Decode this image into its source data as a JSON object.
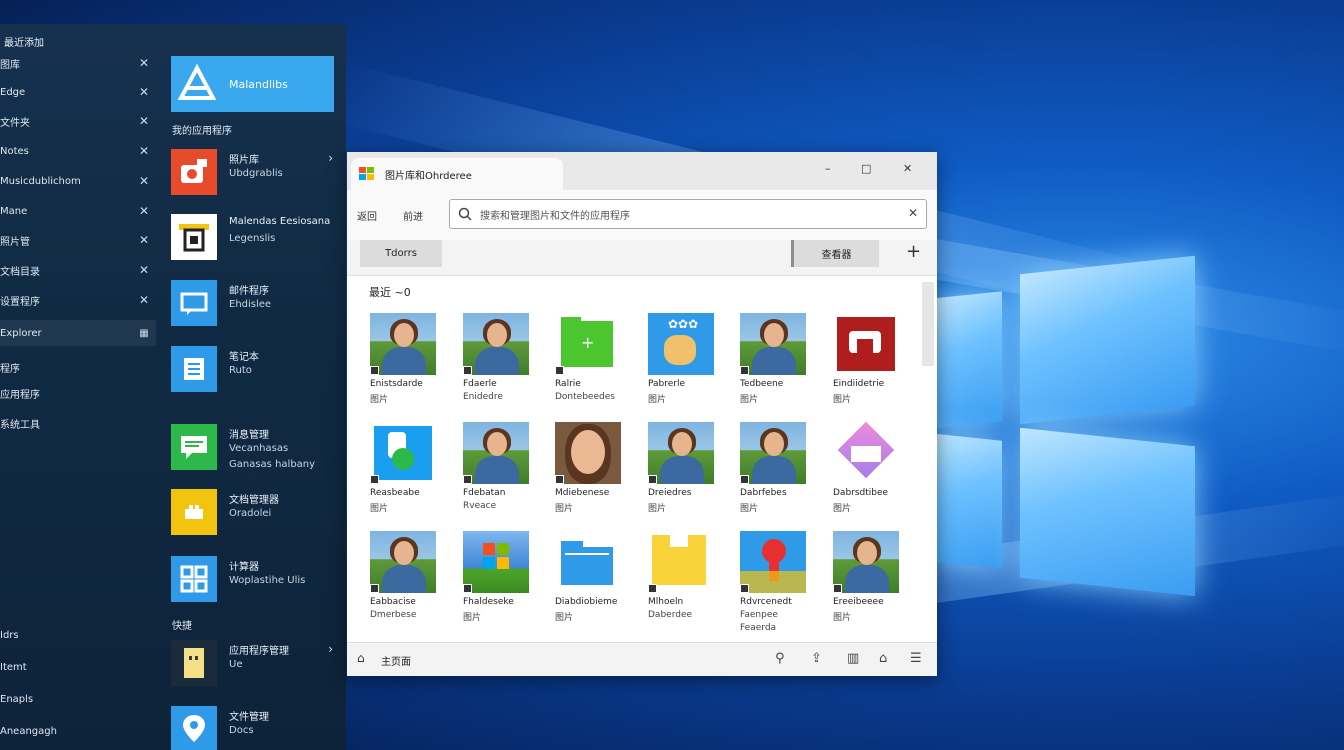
{
  "colors": {
    "hero_tile": "#3aa8ef",
    "start_bg": "#112a44",
    "window_bg": "#f3f3f3",
    "desktop_glow": "#6fc2ff"
  },
  "start_menu": {
    "header": "最近添加",
    "app_list": [
      {
        "label": "图库"
      },
      {
        "label": "Edge"
      },
      {
        "label": "文件夹"
      },
      {
        "label": "Notes"
      },
      {
        "label": "Musicdublichom"
      },
      {
        "label": "Mane"
      },
      {
        "label": "照片管"
      },
      {
        "label": "文档目录"
      },
      {
        "label": "设置程序"
      },
      {
        "label": "Explorer",
        "selected": true
      }
    ],
    "more_items": [
      "程序",
      "应用程序",
      "系统工具"
    ],
    "bottom_items": [
      "Idrs",
      "Itemt",
      "Enapls",
      "Aneangagh"
    ],
    "tiles": {
      "hero_label": "Malandlibs",
      "section1": "我的应用程序",
      "section2": "快捷",
      "items": [
        {
          "title": "照片库",
          "line2": "Ubdgrablis",
          "icon": "camera-icon",
          "color": "#e84a2c",
          "chevron": true
        },
        {
          "title": "Malendas Eesiosana",
          "line2": "Legenslis",
          "icon": "folder-doc-icon",
          "color": "#ffffff"
        },
        {
          "title": "邮件程序",
          "line2": "Ehdislee",
          "icon": "chat-window-icon",
          "color": "#2f9be8"
        },
        {
          "title": "笔记本",
          "line2": "Ruto",
          "icon": "notepad-icon",
          "color": "#2f9be8"
        },
        {
          "title": "消息管理",
          "line2": "Vecanhasas",
          "line3": "Ganasas halbany",
          "icon": "message-icon",
          "color": "#2db84a"
        },
        {
          "title": "文档管理器",
          "line2": "Oradolei",
          "icon": "store-icon",
          "color": "#f2c30f"
        },
        {
          "title": "计算器",
          "line2": "Woplastihe Ulis",
          "icon": "grid-apps-icon",
          "color": "#2f9be8"
        },
        {
          "title": "应用程序管理",
          "line2": "Ue",
          "icon": "sticky-note-icon",
          "color": "#f5e08a",
          "chevron": true
        },
        {
          "title": "文件管理",
          "line2": "Docs",
          "icon": "map-pin-icon",
          "color": "#2f9be8"
        }
      ]
    }
  },
  "explorer": {
    "tab_title": "图片库和Ohrderee",
    "window_controls": [
      "–",
      "□",
      "✕"
    ],
    "nav_back": "返回",
    "nav_label": "前进",
    "search_placeholder": "搜索和管理图片和文件的应用程序",
    "toolbar_left": "Tdorrs",
    "toolbar_right": "查看器",
    "section_heading": "最近 ~0",
    "status_label": "主页面",
    "items": [
      {
        "kind": "person",
        "n1": "Enistsdarde",
        "n2": "图片"
      },
      {
        "kind": "person",
        "n1": "Fdaerle",
        "n2": "Enidedre"
      },
      {
        "kind": "folder-green",
        "n1": "Ralrie",
        "n2": "Dontebeedes"
      },
      {
        "kind": "app-blue",
        "n1": "Pabrerle",
        "n2": "图片"
      },
      {
        "kind": "person",
        "n1": "Tedbeene",
        "n2": "图片"
      },
      {
        "kind": "app-red",
        "n1": "Eindiidetrie",
        "n2": "图片"
      },
      {
        "kind": "app-blue-green",
        "n1": "Reasbeabe",
        "n2": "图片"
      },
      {
        "kind": "person",
        "n1": "Fdebatan",
        "n2": "Rveace"
      },
      {
        "kind": "person-close",
        "n1": "Mdiebenese",
        "n2": "图片"
      },
      {
        "kind": "person",
        "n1": "Dreiedres",
        "n2": "图片"
      },
      {
        "kind": "person",
        "n1": "Dabrfebes",
        "n2": "图片"
      },
      {
        "kind": "app-diamond",
        "n1": "Dabrsdtibee",
        "n2": "图片"
      },
      {
        "kind": "person",
        "n1": "Eabbacise",
        "n2": "Dmerbese"
      },
      {
        "kind": "windows-logo",
        "n1": "Fhaldeseke",
        "n2": "图片"
      },
      {
        "kind": "folder-blue",
        "n1": "Diabdiobieme",
        "n2": "图片"
      },
      {
        "kind": "folder-yellow",
        "n1": "Mlhoeln",
        "n2": "Daberdee"
      },
      {
        "kind": "maps-pin",
        "n1": "Rdvrcenedt",
        "n2": "Faenpee",
        "n3": "Feaerda"
      },
      {
        "kind": "person",
        "n1": "Ereeibeeee",
        "n2": "图片"
      }
    ]
  }
}
